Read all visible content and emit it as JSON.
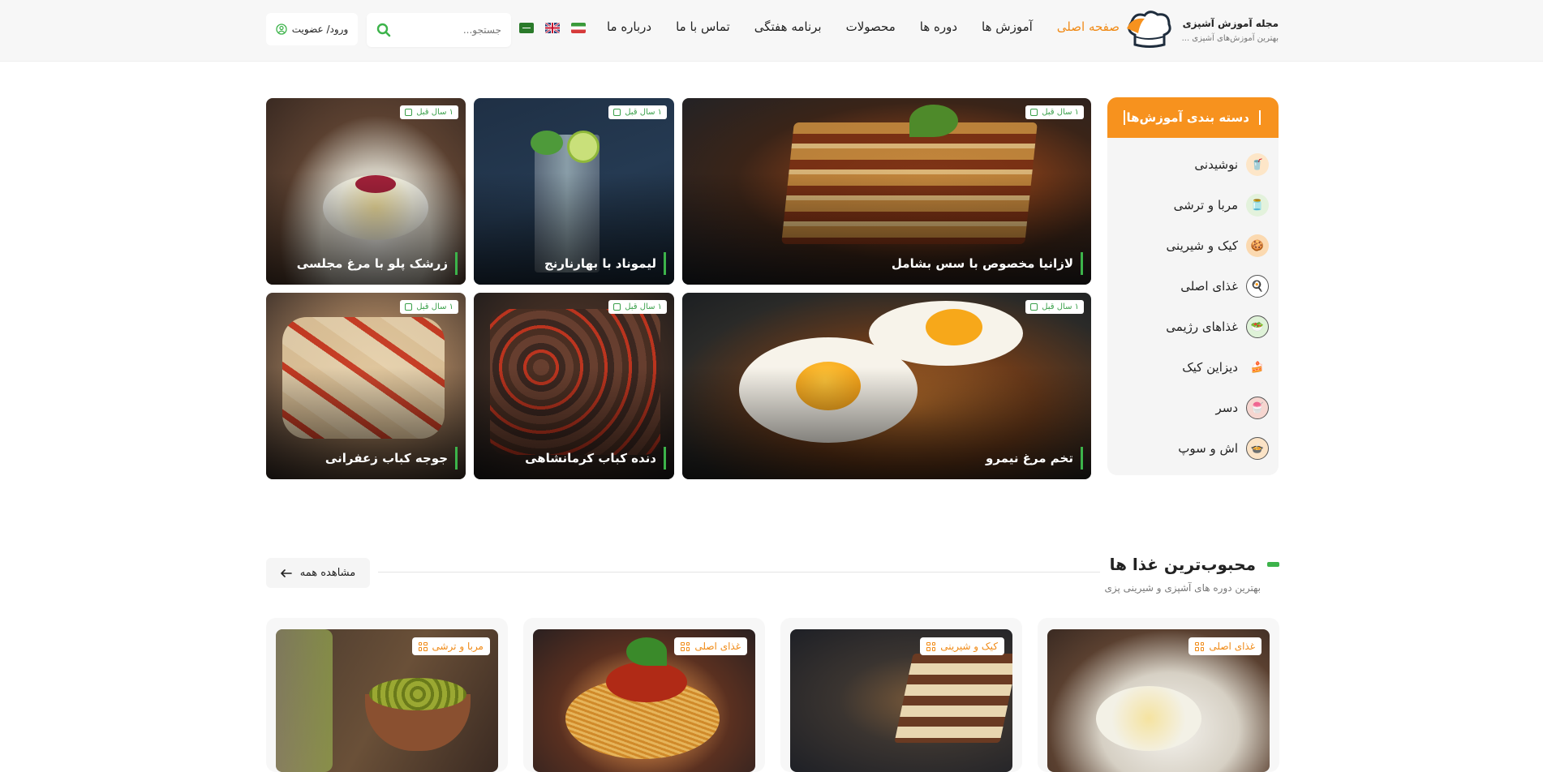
{
  "brand": {
    "title": "مجله آموزش آشپزی",
    "subtitle": "بهترین آموزش‌های آشپزی ..."
  },
  "nav": [
    "صفحه اصلی",
    "آموزش ها",
    "دوره ها",
    "محصولات",
    "برنامه هفتگی",
    "تماس با ما",
    "درباره ما"
  ],
  "search": {
    "placeholder": "جستجو..."
  },
  "login": "ورود/ عضویت",
  "categories": {
    "title": "دسته بندی آموزش‌ها",
    "items": [
      "نوشیدنی",
      "مربا و ترشی",
      "کیک و شیرینی",
      "غذای اصلی",
      "غذاهای رژیمی",
      "دیزاین کیک",
      "دسر",
      "اش و سوپ"
    ]
  },
  "featured": [
    {
      "title": "لازانیا مخصوص با سس بشامل",
      "time": "۱ سال قبل"
    },
    {
      "title": "لیموناد با بهارنارنج",
      "time": "۱ سال قبل"
    },
    {
      "title": "زرشک پلو با مرغ مجلسی",
      "time": "۱ سال قبل"
    },
    {
      "title": "تخم مرغ نیمرو",
      "time": "۱ سال قبل"
    },
    {
      "title": "دنده کباب کرمانشاهی",
      "time": "۱ سال قبل"
    },
    {
      "title": "جوجه کباب زعفرانی",
      "time": "۱ سال قبل"
    }
  ],
  "popular": {
    "title": "محبوب‌ترین غذا ها",
    "subtitle": "بهترین دوره های آشپزی و شیرینی پزی",
    "see_all": "مشاهده همه",
    "cards": [
      {
        "tag": "غذای اصلی"
      },
      {
        "tag": "کیک و شیرینی"
      },
      {
        "tag": "غذای اصلی"
      },
      {
        "tag": "مربا و ترشی"
      }
    ]
  },
  "colors": {
    "accent": "#f7921e",
    "green": "#3cb34a",
    "bg": "#f7f7f7"
  }
}
